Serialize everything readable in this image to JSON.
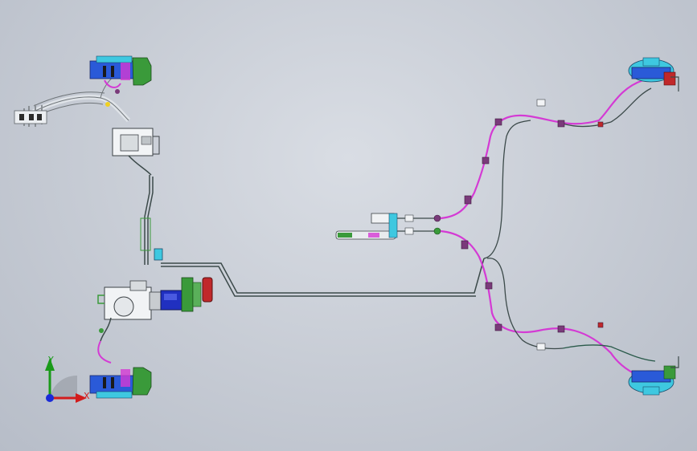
{
  "viewport": {
    "background": "#c8cdd6",
    "description_colors": {
      "brake_line": "#3c4a4a",
      "flex_hose": "#d43ad4",
      "hose_dark": "#5a2a5a",
      "caliper_cyan": "#3ec8e0",
      "caliper_blue": "#2a5ad8",
      "knuckle_green": "#3a9a3a",
      "reservoir_red": "#c0282a",
      "booster_blue": "#2030c0"
    }
  },
  "triad": {
    "y_label": "Y",
    "x_label": "X",
    "y_color": "#1a9a1a",
    "x_color": "#d21c1c",
    "z_color": "#1a2ad8"
  },
  "parts": [
    "front-left-brake-assembly",
    "front-right-brake-assembly",
    "rear-left-brake-assembly",
    "rear-right-brake-assembly",
    "abs-module",
    "master-cylinder",
    "brake-booster",
    "fluid-reservoir",
    "main-brake-line",
    "rear-distribution-junction",
    "parking-brake-lever",
    "wiring-harness"
  ]
}
